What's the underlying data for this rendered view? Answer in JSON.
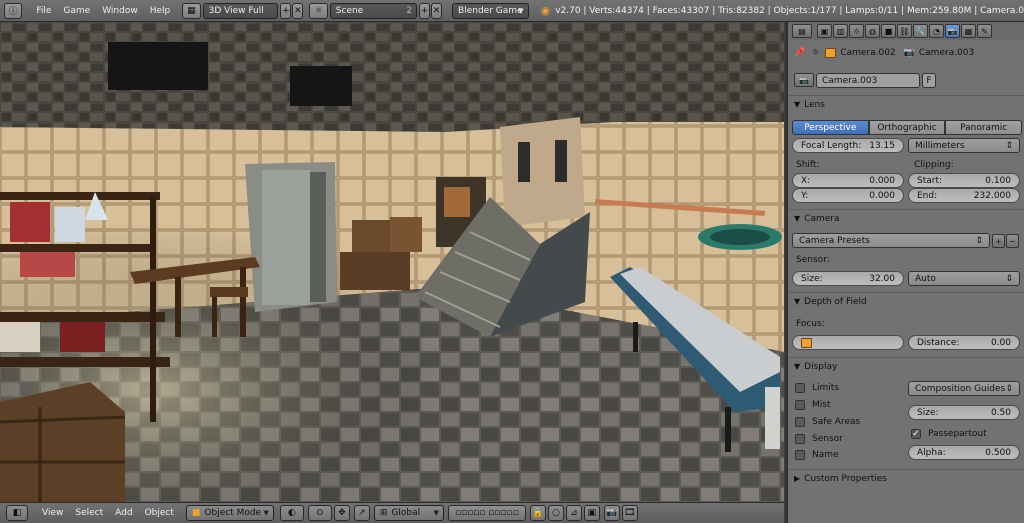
{
  "header": {
    "menus": [
      "File",
      "Game",
      "Window",
      "Help"
    ],
    "layout": "3D View Full",
    "scene": "Scene",
    "scene_users": "2",
    "engine": "Blender Game",
    "stats": "v2.70 | Verts:44374 | Faces:43307 | Tris:82382 | Objects:1/177 | Lamps:0/11 | Mem:259.80M | Camera.0"
  },
  "bottom": {
    "menus": [
      "View",
      "Select",
      "Add",
      "Object"
    ],
    "mode": "Object Mode",
    "orientation": "Global"
  },
  "properties": {
    "breadcrumb": [
      "Camera.002",
      "Camera.003"
    ],
    "datablock_name": "Camera.003",
    "datablock_fake": "F",
    "lens": {
      "title": "Lens",
      "types": [
        "Perspective",
        "Orthographic",
        "Panoramic"
      ],
      "active_type": "Perspective",
      "focal_label": "Focal Length:",
      "focal_value": "13.15",
      "units": "Millimeters",
      "shift_label": "Shift:",
      "shift_x_label": "X:",
      "shift_x": "0.000",
      "shift_y_label": "Y:",
      "shift_y": "0.000",
      "clip_label": "Clipping:",
      "clip_start_label": "Start:",
      "clip_start": "0.100",
      "clip_end_label": "End:",
      "clip_end": "232.000"
    },
    "camera": {
      "title": "Camera",
      "presets": "Camera Presets",
      "sensor_label": "Sensor:",
      "size_label": "Size:",
      "size_value": "32.00",
      "fit": "Auto"
    },
    "dof": {
      "title": "Depth of Field",
      "focus_label": "Focus:",
      "distance_label": "Distance:",
      "distance_value": "0.00"
    },
    "display": {
      "title": "Display",
      "checks": [
        "Limits",
        "Mist",
        "Safe Areas",
        "Sensor",
        "Name"
      ],
      "guides": "Composition Guides",
      "size_label": "Size:",
      "size_value": "0.50",
      "passepartout": "Passepartout",
      "alpha_label": "Alpha:",
      "alpha_value": "0.500"
    },
    "custom": {
      "title": "Custom Properties"
    }
  }
}
